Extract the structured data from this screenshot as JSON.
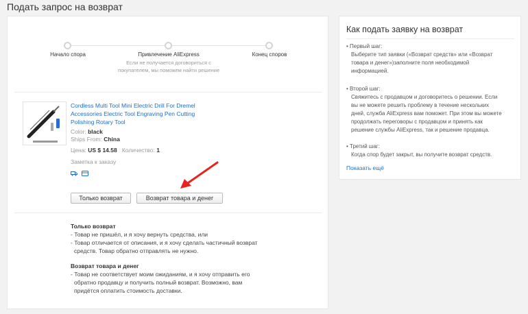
{
  "page": {
    "title": "Подать запрос на возврат"
  },
  "progress": {
    "steps": [
      {
        "label": "Начало спора"
      },
      {
        "label": "Привлечение AliExpress",
        "note": "Если не получается договориться с покупателем, мы поможем найти решение"
      },
      {
        "label": "Конец споров"
      }
    ]
  },
  "product": {
    "title": "Cordless Multi Tool Mini Electric Drill For Dremel Accessories Electric Tool Engraving Pen Cutting Polishing Rotary Tool",
    "color_label": "Color:",
    "color_value": "black",
    "ships_label": "Ships From:",
    "ships_value": "China",
    "price_label": "Цена:",
    "price_value": "US $ 14.58",
    "qty_label": "Количество:",
    "qty_value": "1",
    "order_note": "Заметка к заказу"
  },
  "actions": {
    "refund_only": "Только возврат",
    "return_and_refund": "Возврат товара и денег"
  },
  "explanations": {
    "refund_only": {
      "heading": "Только возврат",
      "line1": "- Товар не пришёл, и я хочу вернуть средства, или",
      "line2": "- Товар отличается от описания, и я хочу сделать частичный возврат",
      "line3": "средств. Товар обратно отправлять не нужно."
    },
    "return_refund": {
      "heading": "Возврат товара и денег",
      "line1": "- Товар не соответствует моим ожиданиям, и я хочу отправить его",
      "line2": "обратно продавцу и получить полный возврат. Возможно, вам",
      "line3": "придётся оплатить стоимость доставки."
    }
  },
  "help": {
    "title": "Как подать заявку на возврат",
    "steps": [
      {
        "heading": "• Первый шаг:",
        "lines": [
          "Выберите тип заявки («Возврат средств» или «Возврат",
          "товара и денег»)заполните поля необходимой",
          "информацией."
        ]
      },
      {
        "heading": "• Второй шаг:",
        "lines": [
          "Свяжитесь с продавцом и договоритесь о решении. Если",
          "вы не можете решить проблему в течение нескольких",
          "дней, служба AliExpress вам поможет. При этом вы можете",
          "продолжать переговоры с продавцом и принять как",
          "решение службы AliExpress, так и решение продавца."
        ]
      },
      {
        "heading": "• Третий шаг:",
        "lines": [
          "Когда спор будет закрыт, вы получите возврат средств."
        ]
      }
    ],
    "show_more": "Показать ещё"
  },
  "colors": {
    "link": "#1d6ec9",
    "arrow": "#e8231f"
  }
}
